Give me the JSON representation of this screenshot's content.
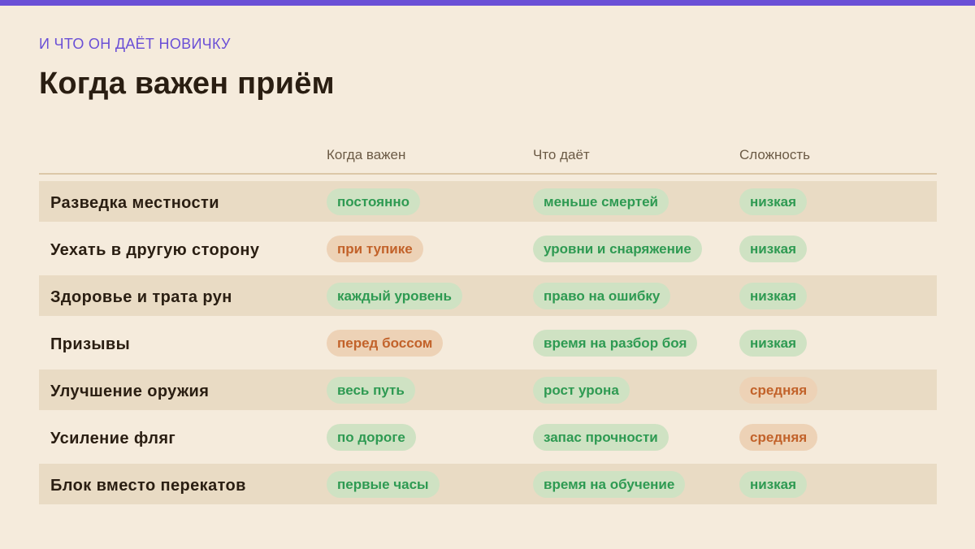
{
  "eyebrow": "И ЧТО ОН ДАЁТ НОВИЧКУ",
  "title": "Когда важен приём",
  "colors": {
    "accent": "#6a4fd6",
    "green_text": "#2e9a52",
    "green_bg": "#cfe2c3",
    "orange_text": "#c2622a",
    "orange_bg": "#edd2b6"
  },
  "table": {
    "headers": [
      "",
      "Когда важен",
      "Что даёт",
      "Сложность"
    ],
    "rows": [
      {
        "label": "Разведка местности",
        "when": {
          "text": "постоянно",
          "tone": "green"
        },
        "gives": {
          "text": "меньше смертей",
          "tone": "green"
        },
        "difficulty": {
          "text": "низкая",
          "tone": "green"
        }
      },
      {
        "label": "Уехать в другую сторону",
        "when": {
          "text": "при тупике",
          "tone": "orange"
        },
        "gives": {
          "text": "уровни и снаряжение",
          "tone": "green"
        },
        "difficulty": {
          "text": "низкая",
          "tone": "green"
        }
      },
      {
        "label": "Здоровье и трата рун",
        "when": {
          "text": "каждый уровень",
          "tone": "green"
        },
        "gives": {
          "text": "право на ошибку",
          "tone": "green"
        },
        "difficulty": {
          "text": "низкая",
          "tone": "green"
        }
      },
      {
        "label": "Призывы",
        "when": {
          "text": "перед боссом",
          "tone": "orange"
        },
        "gives": {
          "text": "время на разбор боя",
          "tone": "green"
        },
        "difficulty": {
          "text": "низкая",
          "tone": "green"
        }
      },
      {
        "label": "Улучшение оружия",
        "when": {
          "text": "весь путь",
          "tone": "green"
        },
        "gives": {
          "text": "рост урона",
          "tone": "green"
        },
        "difficulty": {
          "text": "средняя",
          "tone": "orange"
        }
      },
      {
        "label": "Усиление фляг",
        "when": {
          "text": "по дороге",
          "tone": "green"
        },
        "gives": {
          "text": "запас прочности",
          "tone": "green"
        },
        "difficulty": {
          "text": "средняя",
          "tone": "orange"
        }
      },
      {
        "label": "Блок вместо перекатов",
        "when": {
          "text": "первые часы",
          "tone": "green"
        },
        "gives": {
          "text": "время на обучение",
          "tone": "green"
        },
        "difficulty": {
          "text": "низкая",
          "tone": "green"
        }
      }
    ]
  }
}
